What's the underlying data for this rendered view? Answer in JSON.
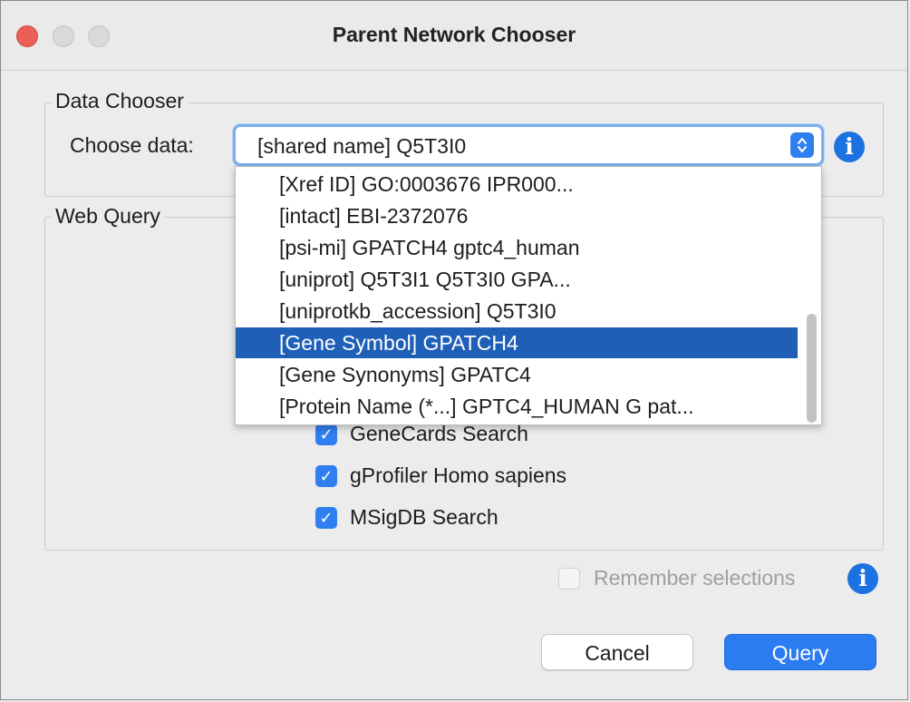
{
  "window": {
    "title": "Parent Network Chooser"
  },
  "data_chooser": {
    "legend": "Data Chooser",
    "choose_label": "Choose data:",
    "selected_value": "[shared name]  Q5T3I0",
    "options": [
      "[Xref ID]  GO:0003676 IPR000...",
      "[intact]  EBI-2372076",
      "[psi-mi]  GPATCH4 gptc4_human",
      "[uniprot]  Q5T3I1 Q5T3I0 GPA...",
      "[uniprotkb_accession]  Q5T3I0",
      "[Gene Symbol]  GPATCH4",
      "[Gene Synonyms]  GPATC4",
      "[Protein Name   (*...]  GPTC4_HUMAN G pat..."
    ],
    "highlighted_index": 5
  },
  "web_query": {
    "legend": "Web Query",
    "searches": [
      {
        "label": "GeneCards Search",
        "checked": true
      },
      {
        "label": "gProfiler Homo sapiens",
        "checked": true
      },
      {
        "label": "MSigDB Search",
        "checked": true
      }
    ]
  },
  "remember": {
    "label": "Remember selections",
    "checked": false
  },
  "buttons": {
    "cancel": "Cancel",
    "query": "Query"
  },
  "icons": {
    "info": "i",
    "check": "✓",
    "arrows": "⌃⌄"
  },
  "colors": {
    "accent": "#2a7cf0",
    "highlight": "#1f5fb8",
    "close": "#ec5f57"
  }
}
